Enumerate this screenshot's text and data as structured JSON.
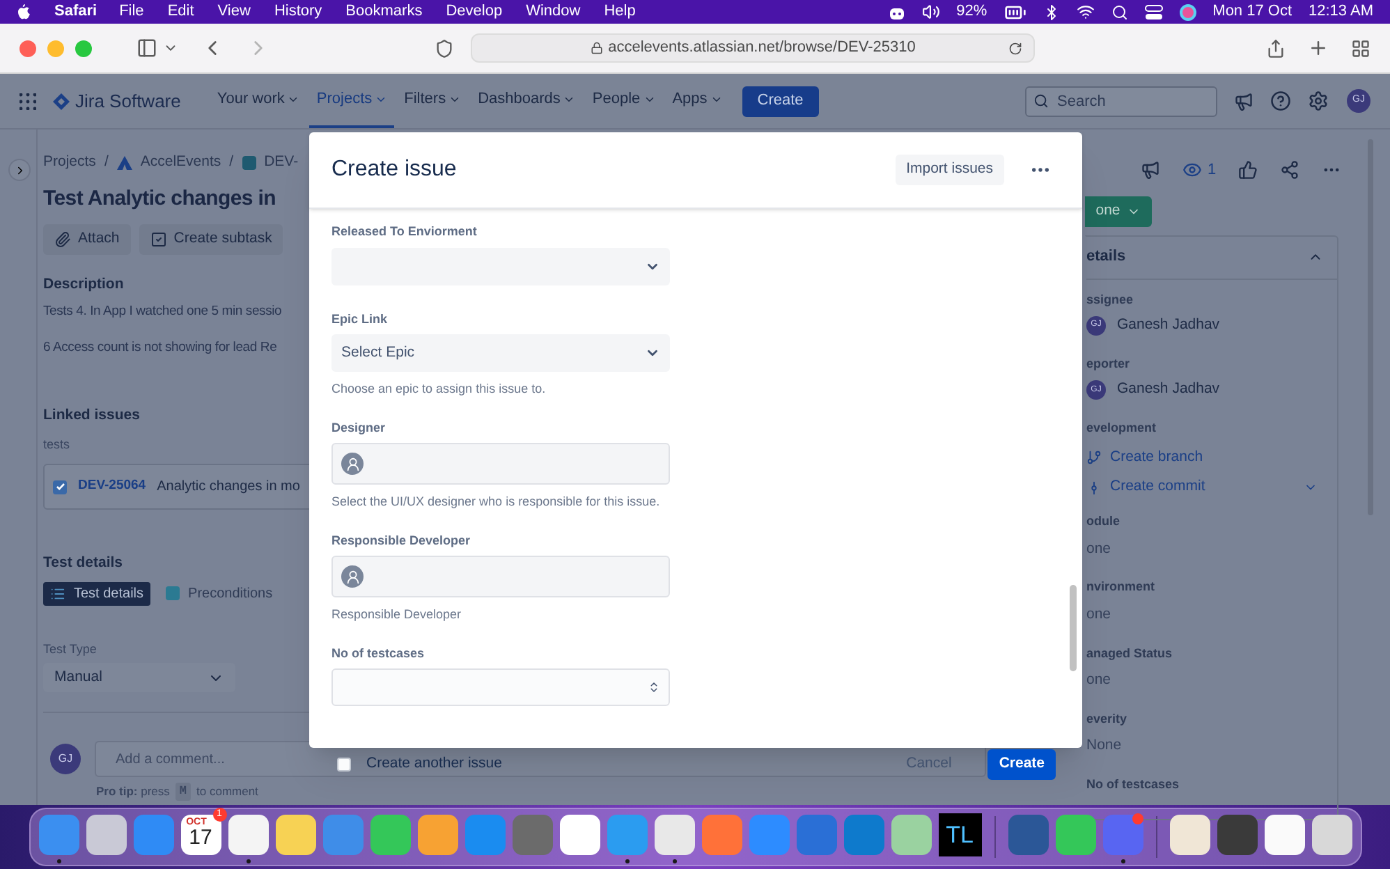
{
  "menubar": {
    "app": "Safari",
    "menus": [
      "File",
      "Edit",
      "View",
      "History",
      "Bookmarks",
      "Develop",
      "Window",
      "Help"
    ],
    "battery": "92%",
    "date": "Mon 17 Oct",
    "time": "12:13 AM"
  },
  "browser": {
    "url": "accelevents.atlassian.net/browse/DEV-25310"
  },
  "jira_nav": {
    "product": "Jira Software",
    "items": [
      {
        "label": "Your work",
        "selected": false
      },
      {
        "label": "Projects",
        "selected": true
      },
      {
        "label": "Filters",
        "selected": false
      },
      {
        "label": "Dashboards",
        "selected": false
      },
      {
        "label": "People",
        "selected": false
      },
      {
        "label": "Apps",
        "selected": false
      }
    ],
    "create": "Create",
    "search": {
      "placeholder": "Search"
    },
    "avatar": "GJ"
  },
  "issue": {
    "breadcrumbs": [
      {
        "label": "Projects",
        "separator": "/"
      },
      {
        "label": "AccelEvents",
        "separator": "/"
      },
      {
        "label": "DEV-"
      }
    ],
    "title": "Test Analytic changes in",
    "actions": [
      "Attach",
      "Create subtask"
    ],
    "description": {
      "heading": "Description",
      "lines": [
        "Tests 4. In App I watched one 5 min sessio",
        "6 Access count is not showing for lead Re"
      ]
    },
    "linked_issues": {
      "heading": "Linked issues",
      "relation": "tests",
      "items": [
        {
          "key": "DEV-25064",
          "summary": "Analytic changes in mo",
          "done": true
        }
      ]
    },
    "test_details": {
      "heading": "Test details",
      "tabs": [
        {
          "label": "Test details",
          "selected": true
        },
        {
          "label": "Preconditions",
          "selected": false
        }
      ],
      "test_type_label": "Test Type",
      "test_type": "Manual"
    },
    "comment": {
      "avatar": "GJ",
      "placeholder": "Add a comment...",
      "tip": "**Pro tip:** press",
      "key": "M",
      "tip_end": "to comment"
    }
  },
  "right_panel": {
    "watchers": "1",
    "status": "one",
    "details_title": "etails",
    "expanded": true,
    "fields": [
      {
        "kind": "user",
        "label": "ssignee",
        "value": "Ganesh Jadhav",
        "avatar": "GJ"
      },
      {
        "kind": "user",
        "label": "eporter",
        "value": "Ganesh Jadhav",
        "avatar": "GJ"
      },
      {
        "kind": "dev",
        "label": "evelopment",
        "links": [
          "Create branch",
          "Create commit"
        ]
      },
      {
        "kind": "text",
        "label": "odule",
        "value": "one"
      },
      {
        "kind": "text",
        "label": "nvironment",
        "value": "one"
      },
      {
        "kind": "text",
        "label": "anaged Status",
        "value": "one"
      },
      {
        "kind": "text",
        "label": "everity",
        "value": "None"
      },
      {
        "kind": "label",
        "label": "No of testcases"
      }
    ]
  },
  "modal": {
    "title": "Create issue",
    "import": "Import issues",
    "fields": [
      {
        "kind": "select",
        "label": "Released To Enviorment"
      },
      {
        "kind": "select",
        "label": "Epic Link",
        "value": "Select Epic",
        "help": "Choose an epic to assign this issue to."
      },
      {
        "kind": "user",
        "label": "Designer",
        "help": "Select the UI/UX designer who is responsible for this issue."
      },
      {
        "kind": "user",
        "label": "Responsible Developer",
        "help": "Responsible Developer"
      },
      {
        "kind": "number",
        "label": "No of testcases"
      }
    ],
    "another": {
      "label": "Create another issue",
      "checked": false
    },
    "cancel": "Cancel",
    "submit": "Create"
  },
  "dock": [
    {
      "kind": "app",
      "color": "#3b8ff0",
      "running": true,
      "alert": false
    },
    {
      "kind": "app",
      "color": "#c9c9d6",
      "running": false,
      "alert": false
    },
    {
      "kind": "app",
      "color": "#2f8bf5",
      "running": false,
      "alert": false
    },
    {
      "kind": "calendar",
      "month": "OCT",
      "day": "17",
      "badge": "1",
      "running": false,
      "alert": false
    },
    {
      "kind": "app",
      "color": "#f4f4f4",
      "running": true,
      "alert": false
    },
    {
      "kind": "app",
      "color": "#f7d254",
      "running": false,
      "alert": false
    },
    {
      "kind": "app",
      "color": "#3f8de8",
      "running": false,
      "alert": false
    },
    {
      "kind": "app",
      "color": "#34c759",
      "running": false,
      "alert": false
    },
    {
      "kind": "app",
      "color": "#f7a233",
      "running": false,
      "alert": false
    },
    {
      "kind": "app",
      "color": "#1a8cf0",
      "running": false,
      "alert": false
    },
    {
      "kind": "app",
      "color": "#6b6b6b",
      "running": false,
      "alert": false
    },
    {
      "kind": "app",
      "color": "#ffffff",
      "running": false,
      "alert": false
    },
    {
      "kind": "app",
      "color": "#2b9cf0",
      "running": true,
      "alert": false
    },
    {
      "kind": "app",
      "color": "#e8e8e8",
      "running": true,
      "alert": false
    },
    {
      "kind": "app",
      "color": "#ff7139",
      "running": false,
      "alert": false
    },
    {
      "kind": "app",
      "color": "#2d8cff",
      "running": false,
      "alert": false
    },
    {
      "kind": "app",
      "color": "#2a6fd6",
      "running": false,
      "alert": false
    },
    {
      "kind": "app",
      "color": "#0e7acc",
      "running": false,
      "alert": false
    },
    {
      "kind": "app",
      "color": "#9ad2a0",
      "running": false,
      "alert": false
    },
    {
      "kind": "text",
      "label": "TL",
      "running": false,
      "alert": false
    },
    {
      "kind": "separator"
    },
    {
      "kind": "app",
      "color": "#2b5797",
      "running": false,
      "alert": false
    },
    {
      "kind": "app",
      "color": "#34c759",
      "running": false,
      "alert": false
    },
    {
      "kind": "app",
      "color": "#5865f2",
      "running": true,
      "alert": true
    },
    {
      "kind": "separator"
    },
    {
      "kind": "app",
      "color": "#f0e6d6",
      "running": false,
      "alert": false
    },
    {
      "kind": "app",
      "color": "#3a3a3a",
      "running": false,
      "alert": false
    },
    {
      "kind": "app",
      "color": "#fafafa",
      "running": false,
      "alert": false
    },
    {
      "kind": "app",
      "color": "#d8d8d8",
      "running": false,
      "alert": false
    }
  ]
}
